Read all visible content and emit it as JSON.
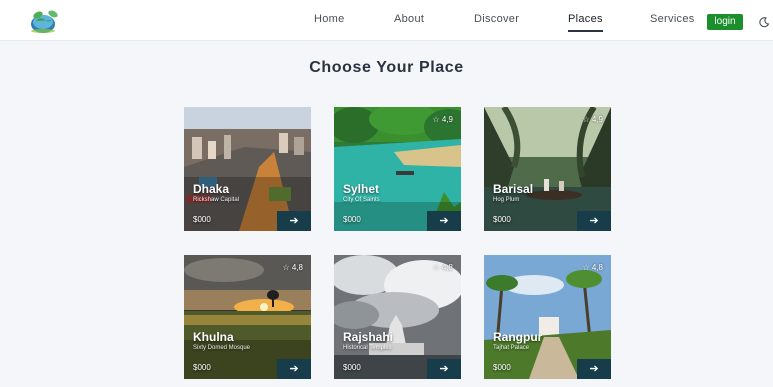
{
  "nav": {
    "links": [
      "Home",
      "About",
      "Discover",
      "Places",
      "Services"
    ],
    "active": "Places",
    "login_label": "login"
  },
  "heading": "Choose Your Place",
  "places": [
    {
      "name": "Dhaka",
      "subtitle": "Rickshaw Capital",
      "price": "$000",
      "rating": ""
    },
    {
      "name": "Sylhet",
      "subtitle": "City Of Saints",
      "price": "$000",
      "rating": "☆ 4,9"
    },
    {
      "name": "Barisal",
      "subtitle": "Hog Plum",
      "price": "$000",
      "rating": "☆ 4,9"
    },
    {
      "name": "Khulna",
      "subtitle": "Sixty Domed Mosque",
      "price": "$000",
      "rating": "☆ 4,8"
    },
    {
      "name": "Rajshahi",
      "subtitle": "Historical Temples",
      "price": "$000",
      "rating": "☆ 4,8"
    },
    {
      "name": "Rangpur",
      "subtitle": "Tajhat Palace",
      "price": "$000",
      "rating": "☆ 4,8"
    }
  ],
  "icons": {
    "logo": "globe-leaf-logo",
    "theme": "moon-icon",
    "card_button": "arrow-right-icon"
  },
  "colors": {
    "accent_green": "#1b8f2c",
    "card_button": "#173d4a",
    "heading": "#2a3441"
  }
}
